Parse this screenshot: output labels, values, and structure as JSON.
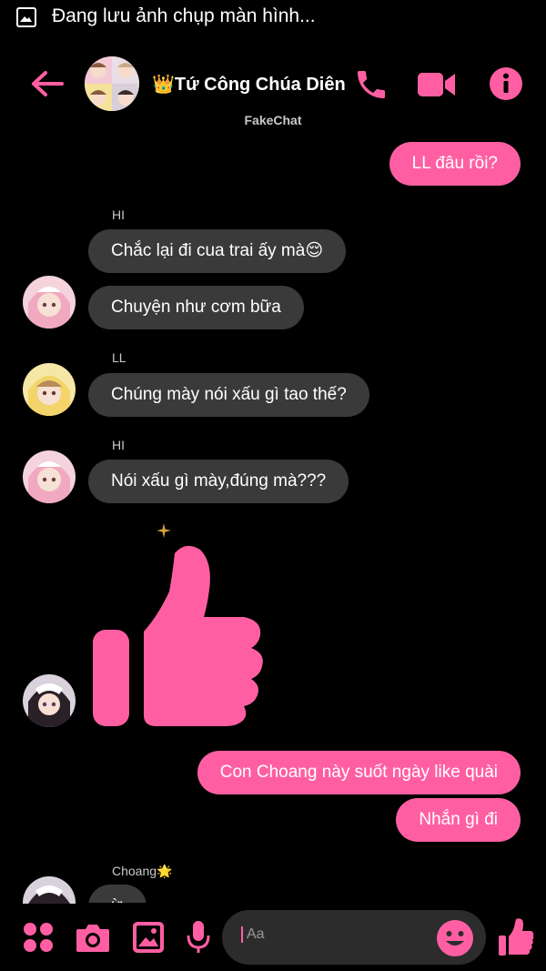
{
  "status_bar": {
    "text": "Đang lưu ảnh chụp màn hình..."
  },
  "header": {
    "title": "👑Tứ Công Chúa Diên...",
    "app_label": "FakeChat"
  },
  "messages": [
    {
      "type": "me",
      "text": "LL đâu rồi?"
    },
    {
      "type": "sender",
      "text": "HI"
    },
    {
      "type": "them",
      "text": "Chắc lại đi cua trai ấy mà😌"
    },
    {
      "type": "them",
      "text": "Chuyện như cơm bữa"
    },
    {
      "type": "sender",
      "text": "LL"
    },
    {
      "type": "them",
      "text": "Chúng mày nói xấu gì tao thế?"
    },
    {
      "type": "sender",
      "text": "HI"
    },
    {
      "type": "them",
      "text": "Nói xấu gì mày,đúng mà???"
    },
    {
      "type": "me",
      "text": "Con Choang này suốt ngày like quài"
    },
    {
      "type": "me",
      "text": "Nhắn gì đi"
    },
    {
      "type": "sender",
      "text": "Choang🌟"
    },
    {
      "type": "them",
      "text": "ừ"
    }
  ],
  "composer": {
    "placeholder": "Aa"
  },
  "colors": {
    "accent": "#ff5fa2",
    "incoming_bubble": "#3a3a3a",
    "background": "#000000"
  },
  "icons": {
    "header": [
      "back-arrow-icon",
      "phone-icon",
      "video-camera-icon",
      "info-icon"
    ],
    "footer": [
      "apps-icon",
      "camera-icon",
      "gallery-icon",
      "microphone-icon",
      "emoji-icon",
      "thumbs-up-icon"
    ]
  }
}
